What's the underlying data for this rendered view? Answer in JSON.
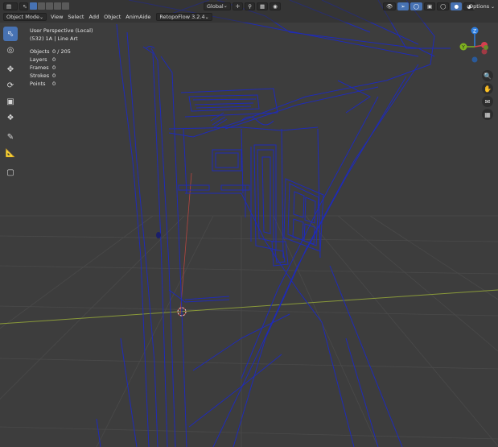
{
  "header": {
    "mode_label": "Object Mode",
    "menu": [
      "View",
      "Select",
      "Add",
      "Object",
      "AnimAide"
    ],
    "retopoflow_label": "RetopoFlow 3.2.4",
    "transform_orientation": "Global",
    "options_label": "Options"
  },
  "overlay": {
    "view_name": "User Perspective (Local)",
    "context": "(532) 1A | Line Art"
  },
  "stats": [
    {
      "label": "Objects",
      "value": "0 / 205"
    },
    {
      "label": "Layers",
      "value": "0"
    },
    {
      "label": "Frames",
      "value": "0"
    },
    {
      "label": "Strokes",
      "value": "0"
    },
    {
      "label": "Points",
      "value": "0"
    }
  ],
  "gizmo": {
    "z_label": "Z",
    "y_label": "Y",
    "x_color": "#d63f4f",
    "y_color": "#7fb21e",
    "z_color": "#2f7fe0"
  },
  "colors": {
    "viewport_bg": "#3d3d3d",
    "grid": "#4a4a4a",
    "line_art": "#1f2bb8",
    "accent": "#4772b3",
    "x_axis": "#8a9a3a"
  },
  "tools": [
    "cursor-select",
    "cursor-3d",
    "move",
    "rotate",
    "scale",
    "transform",
    "annotate",
    "measure",
    "add-cube"
  ]
}
